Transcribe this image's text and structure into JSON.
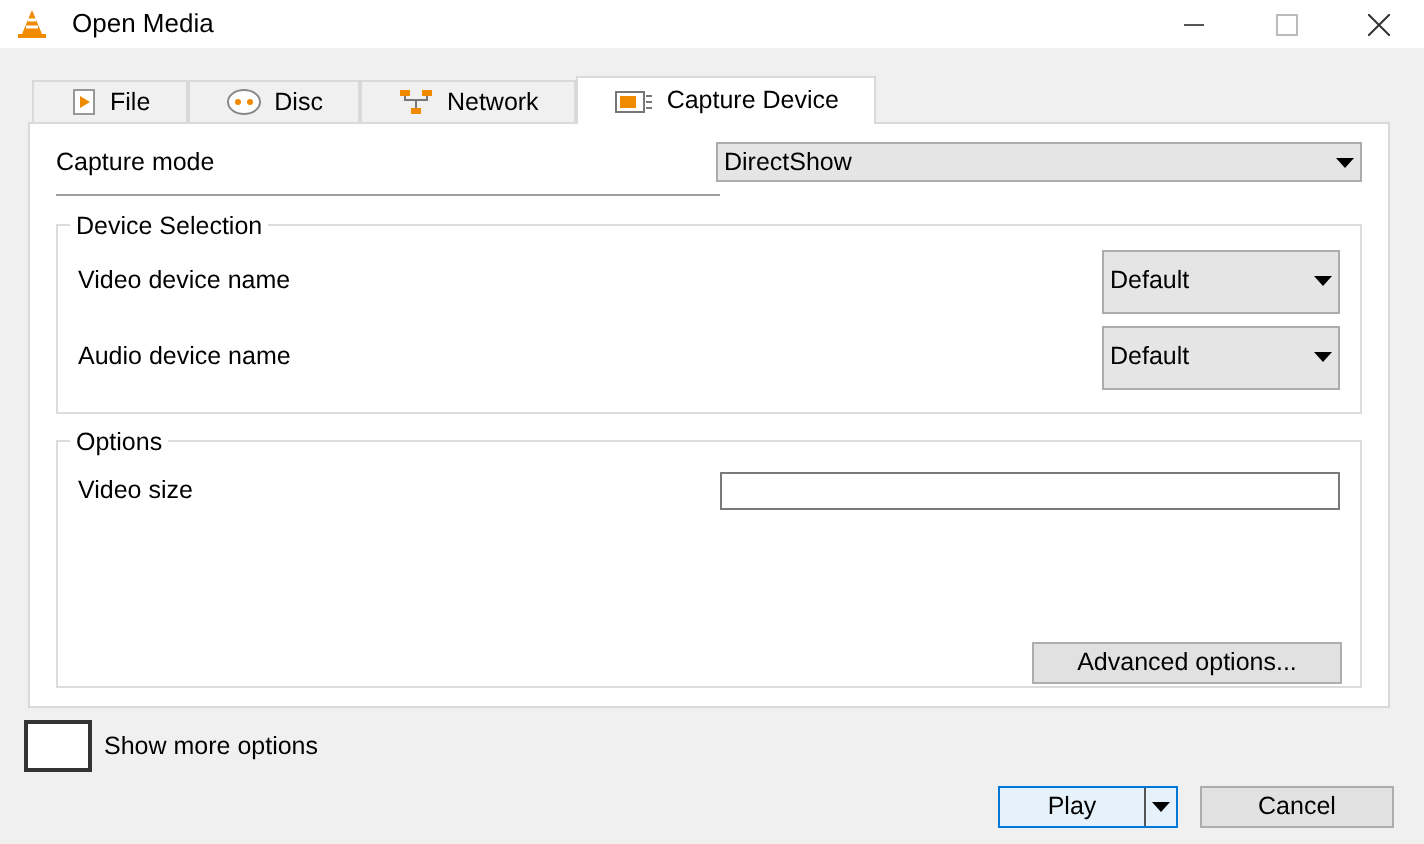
{
  "window": {
    "title": "Open Media"
  },
  "tabs": [
    {
      "label": "File",
      "kind": "file",
      "selected": false
    },
    {
      "label": "Disc",
      "kind": "disc",
      "selected": false
    },
    {
      "label": "Network",
      "kind": "network",
      "selected": false
    },
    {
      "label": "Capture Device",
      "kind": "capture",
      "selected": true
    }
  ],
  "capture_mode": {
    "label": "Capture mode",
    "value": "DirectShow"
  },
  "device_selection": {
    "title": "Device Selection",
    "rows": [
      {
        "label": "Video device name",
        "value": "Default"
      },
      {
        "label": "Audio device name",
        "value": "Default"
      }
    ]
  },
  "options": {
    "title": "Options",
    "video_size": {
      "label": "Video size"
    },
    "advanced_button": "Advanced options..."
  },
  "show_more_options": {
    "label": "Show more options",
    "checked": false
  },
  "play_button": "Play",
  "cancel_button": "Cancel"
}
